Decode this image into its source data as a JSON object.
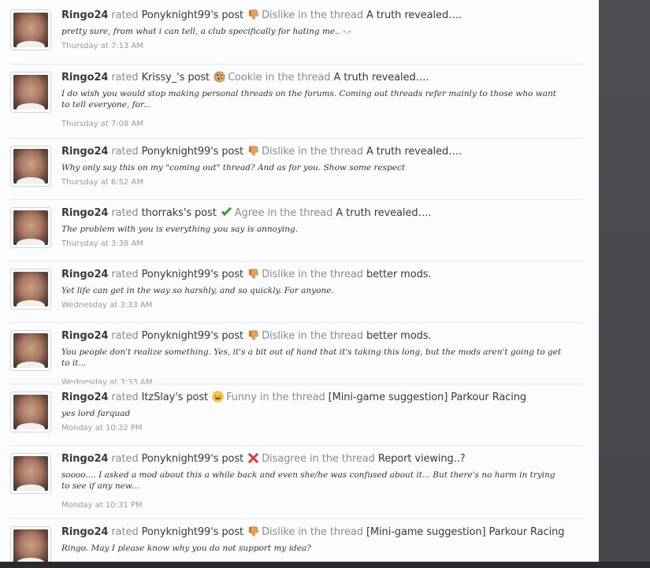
{
  "feed": {
    "items": [
      {
        "user": "Ringo24",
        "rated": "rated",
        "target": "Ponyknight99's post",
        "icon": "dislike-icon",
        "rating": "Dislike",
        "in_thread": "in the thread",
        "thread": "A truth revealed….",
        "snippet": "pretty sure, from what i can tell, a club specifically for hating me.. -.-",
        "time": "Thursday at 7:13 AM"
      },
      {
        "user": "Ringo24",
        "rated": "rated",
        "target": "Krissy_'s post",
        "icon": "cookie-icon",
        "rating": "Cookie",
        "in_thread": "in the thread",
        "thread": "A truth revealed….",
        "snippet": "I do wish you would stop making personal threads on the forums. Coming out threads refer mainly to those who want to tell everyone, for...",
        "time": "Thursday at 7:08 AM"
      },
      {
        "user": "Ringo24",
        "rated": "rated",
        "target": "Ponyknight99's post",
        "icon": "dislike-icon",
        "rating": "Dislike",
        "in_thread": "in the thread",
        "thread": "A truth revealed….",
        "snippet": "Why only say this on my \"coming out\" thread? And as for you. Show some respect",
        "time": "Thursday at 6:52 AM"
      },
      {
        "user": "Ringo24",
        "rated": "rated",
        "target": "thorraks's post",
        "icon": "agree-icon",
        "rating": "Agree",
        "in_thread": "in the thread",
        "thread": "A truth revealed….",
        "snippet": "The problem with you is everything you say is annoying.",
        "time": "Thursday at 3:38 AM"
      },
      {
        "user": "Ringo24",
        "rated": "rated",
        "target": "Ponyknight99's post",
        "icon": "dislike-icon",
        "rating": "Dislike",
        "in_thread": "in the thread",
        "thread": "better mods.",
        "snippet": "Yet life can get in the way so harshly, and so quickly. For anyone.",
        "time": "Wednesday at 3:33 AM"
      },
      {
        "user": "Ringo24",
        "rated": "rated",
        "target": "Ponyknight99's post",
        "icon": "dislike-icon",
        "rating": "Dislike",
        "in_thread": "in the thread",
        "thread": "better mods.",
        "snippet": "You people don't realize something. Yes, it's a bit out of hand that it's taking this long, but the mods aren't going to get to it...",
        "time": "Wednesday at 3:33 AM"
      },
      {
        "user": "Ringo24",
        "rated": "rated",
        "target": "ItzSlay's post",
        "icon": "funny-icon",
        "rating": "Funny",
        "in_thread": "in the thread",
        "thread": "[Mini-game suggestion] Parkour Racing",
        "snippet": "yes lord farquad",
        "time": "Monday at 10:32 PM"
      },
      {
        "user": "Ringo24",
        "rated": "rated",
        "target": "Ponyknight99's post",
        "icon": "disagree-icon",
        "rating": "Disagree",
        "in_thread": "in the thread",
        "thread": "Report viewing..?",
        "snippet": "soooo.... I asked a mod about this a while back and even she/he was confused about it... But there's no harm in trying to see if any new...",
        "time": "Monday at 10:31 PM"
      },
      {
        "user": "Ringo24",
        "rated": "rated",
        "target": "Ponyknight99's post",
        "icon": "dislike-icon",
        "rating": "Dislike",
        "in_thread": "in the thread",
        "thread": "[Mini-game suggestion] Parkour Racing",
        "snippet": "Ringo. May I please know why you do not support my idea?",
        "time": ""
      }
    ]
  }
}
